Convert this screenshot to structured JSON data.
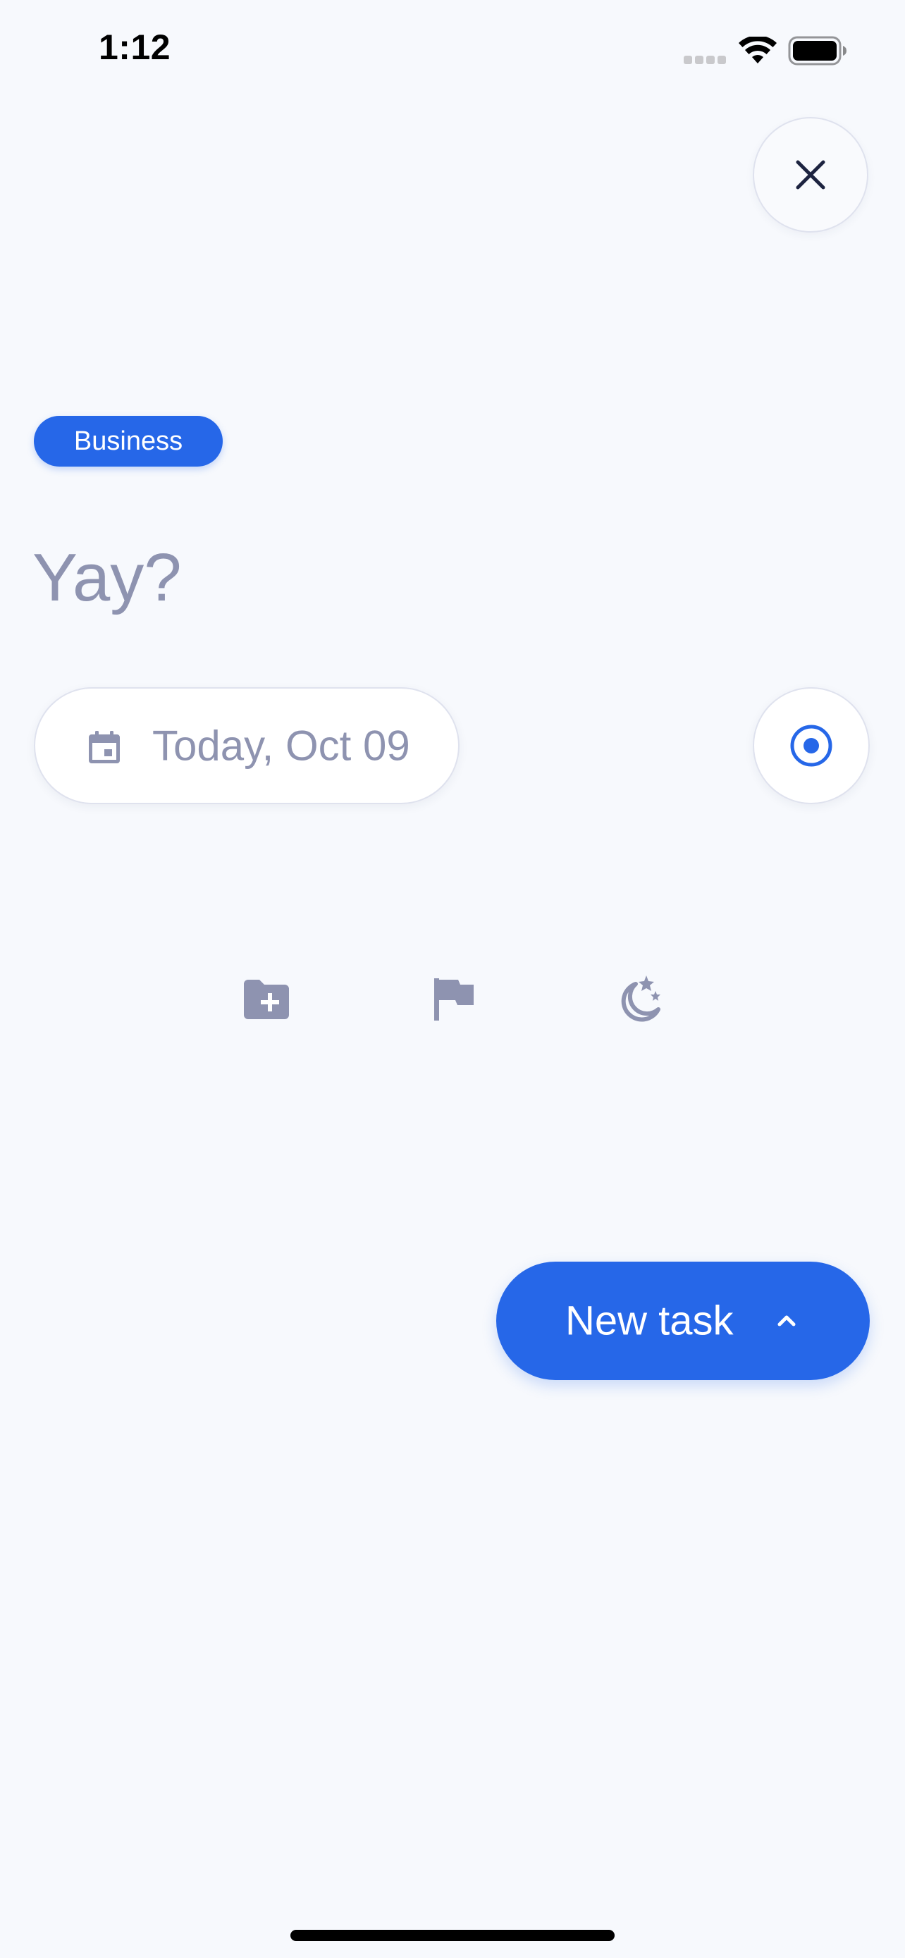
{
  "status_bar": {
    "time": "1:12",
    "icons": [
      "cellular-signal-icon",
      "wifi-icon",
      "battery-icon"
    ]
  },
  "header": {
    "close_icon": "close-icon"
  },
  "task": {
    "category": "Business",
    "title_placeholder": "Yay?",
    "title_value": "",
    "date": "Today, Oct 09",
    "date_icon": "calendar-icon"
  },
  "actions": [
    {
      "icon": "folder-add-icon"
    },
    {
      "icon": "flag-icon"
    },
    {
      "icon": "moon-stars-icon"
    }
  ],
  "primary_button": {
    "label": "New task",
    "icon": "chevron-up-icon"
  },
  "colors": {
    "background": "#f7f9fd",
    "accent": "#2667e8",
    "muted_text": "#8e93b0",
    "icon_dark": "#1d2340",
    "border": "#dfe2ee"
  }
}
